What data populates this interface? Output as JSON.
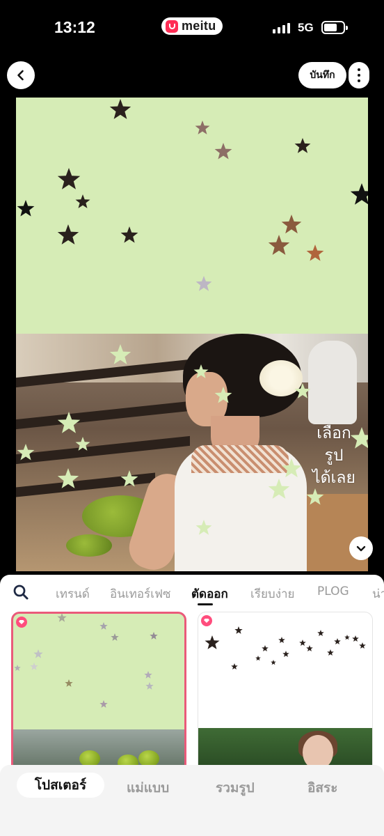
{
  "status_bar": {
    "time": "13:12",
    "app_name": "meitu",
    "network": "5G",
    "battery_percent": 70
  },
  "header": {
    "save_label": "บันทึก",
    "back_icon": "chevron-left-icon",
    "more_icon": "vertical-dots-icon"
  },
  "canvas": {
    "background_color": "#d6ecb6",
    "handwritten_text": [
      "เลือก",
      "รูป",
      "ได้เลย"
    ]
  },
  "template_tabs": {
    "items": [
      "เทรนด์",
      "อินเทอร์เฟซ",
      "ตัดออก",
      "เรียบง่าย",
      "PLOG",
      "น่า"
    ],
    "active": "ตัดออก"
  },
  "bottom_nav": {
    "items": [
      "โปสเตอร์",
      "แม่แบบ",
      "รวมรูป",
      "อิสระ"
    ],
    "active": "โปสเตอร์"
  },
  "colors": {
    "accent_pink": "#ea5a7a",
    "poster_green": "#d6ecb6"
  }
}
